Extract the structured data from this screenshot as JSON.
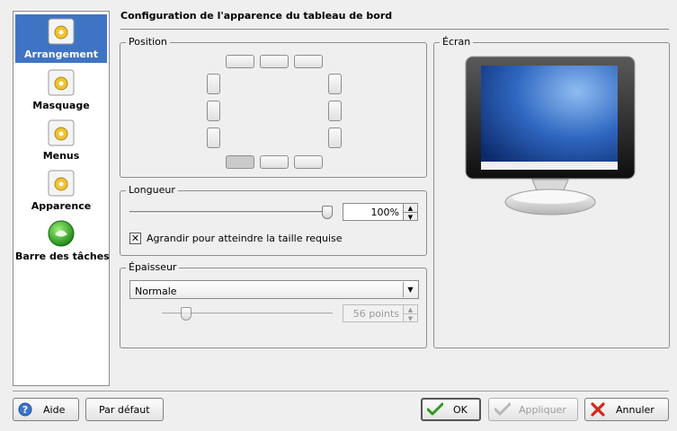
{
  "sidebar": {
    "items": [
      {
        "label": "Arrangement",
        "icon": "gear-icon",
        "selected": true
      },
      {
        "label": "Masquage",
        "icon": "gear-icon"
      },
      {
        "label": "Menus",
        "icon": "gear-icon"
      },
      {
        "label": "Apparence",
        "icon": "gear-icon"
      },
      {
        "label": "Barre des tâches",
        "icon": "suse-icon"
      }
    ]
  },
  "page": {
    "title": "Configuration de l'apparence du tableau de bord"
  },
  "position": {
    "title": "Position",
    "selected": "bottom-left"
  },
  "ecran": {
    "title": "Écran"
  },
  "longueur": {
    "title": "Longueur",
    "slider_value_percent": 100,
    "spin_value": "100%",
    "expand_checked": true,
    "expand_label": "Agrandir pour atteindre la taille requise"
  },
  "epaisseur": {
    "title": "Épaisseur",
    "combo_value": "Normale",
    "spin_value": "56 points",
    "slider_value_fraction": 0.12
  },
  "buttons": {
    "help": "Aide",
    "defaults": "Par défaut",
    "ok": "OK",
    "apply": "Appliquer",
    "cancel": "Annuler"
  },
  "colors": {
    "selection": "#3f74c4",
    "ok_check": "#2e9a1f",
    "cancel_x": "#d6261b"
  }
}
